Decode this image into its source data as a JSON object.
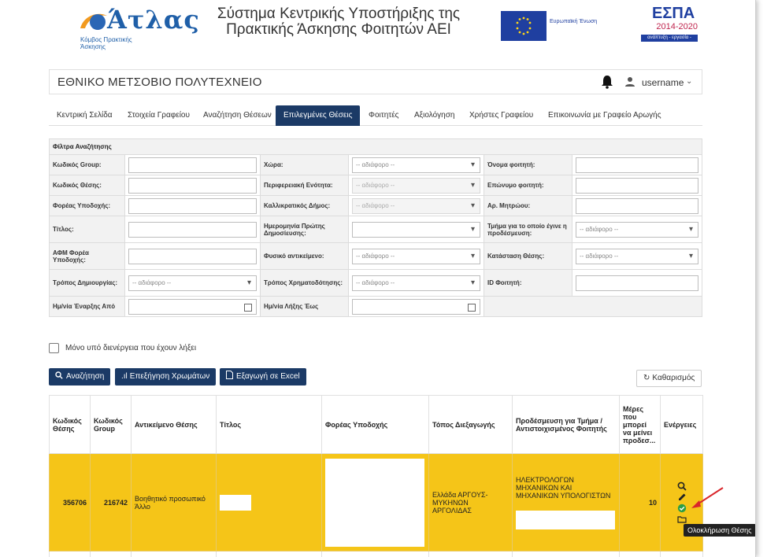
{
  "header": {
    "logo_title": "Άτλας",
    "logo_subtitle": "Κόμβος Πρακτικής Άσκησης",
    "system_title_line1": "Σύστημα Κεντρικής Υποστήριξης της",
    "system_title_line2": "Πρακτικής Άσκησης Φοιτητών ΑΕΙ",
    "eu_text": "Ευρωπαϊκή Ένωση",
    "espa_title": "ΕΣΠΑ",
    "espa_years": "2014-2020",
    "espa_slogan": "ανάπτυξη - εργασία - αλληλεγγύη"
  },
  "topbar": {
    "institution": "ΕΘΝΙΚΟ ΜΕΤΣΟΒΙΟ ΠΟΛΥΤΕΧΝΕΙΟ",
    "username": "username"
  },
  "nav": {
    "tabs": [
      "Κεντρική Σελίδα",
      "Στοιχεία Γραφείου",
      "Αναζήτηση Θέσεων",
      "Επιλεγμένες Θέσεις",
      "Φοιτητές",
      "Αξιολόγηση",
      "Χρήστες Γραφείου",
      "Επικοινωνία με Γραφείο Αρωγής"
    ],
    "active_index": 3
  },
  "filters": {
    "title": "Φίλτρα Αναζήτησης",
    "any": "-- αδιάφορο --",
    "group_code": "Κωδικός Group:",
    "country": "Χώρα:",
    "student_name": "Όνομα φοιτητή:",
    "position_code": "Κωδικός Θέσης:",
    "regional_unit": "Περιφερειακή Ενότητα:",
    "student_surname": "Επώνυμο φοιτητή:",
    "host_org": "Φορέας Υποδοχής:",
    "municipality": "Καλλικρατικός Δήμος:",
    "reg_number": "Αρ. Μητρώου:",
    "title_label": "Τίτλος:",
    "first_pub_date": "Ημερομηνία Πρώτης Δημοσίευσης:",
    "dept_preassigned": "Τμήμα για το οποίο έγινε η προδέσμευση:",
    "host_afm": "ΑΦΜ Φορέα Υποδοχής:",
    "physical_object": "Φυσικό αντικείμενο:",
    "position_status": "Κατάσταση Θέσης:",
    "creation_method": "Τρόπος Δημιουργίας:",
    "funding_method": "Τρόπος Χρηματοδότησης:",
    "student_id": "ID Φοιτητή:",
    "start_date_from": "Ημ/νία Έναρξης Από",
    "end_date_to": "Ημ/νία Λήξης Έως"
  },
  "checkbox_label": "Μόνο υπό διενέργεια που έχουν λήξει",
  "buttons": {
    "search": "Αναζήτηση",
    "color_legend": "Επεξήγηση Χρωμάτων",
    "export_excel": "Εξαγωγή σε Excel",
    "clear": "Καθαρισμός"
  },
  "table": {
    "headers": [
      "Κωδικός Θέσης",
      "Κωδικός Group",
      "Αντικείμενο Θέσης",
      "Τίτλος",
      "Φορέας Υποδοχής",
      "Τόπος Διεξαγωγής",
      "Προδέσμευση για Τμήμα / Αντιστοιχισμένος Φοιτητής",
      "Μέρες που μπορεί να μείνει προδεσ...",
      "Ενέργειες"
    ],
    "row": {
      "position_code": "356706",
      "group_code": "216742",
      "subject": "Βοηθητικό προσωπικό Άλλο",
      "location": "Ελλάδα ΑΡΓΟΥΣ-ΜΥΚΗΝΩΝ ΑΡΓΟΛΙΔΑΣ",
      "department": "ΗΛΕΚΤΡΟΛΟΓΩΝ ΜΗΧΑΝΙΚΩΝ ΚΑΙ ΜΗΧΑΝΙΚΩΝ ΥΠΟΛΟΓΙΣΤΩΝ",
      "days_left": "10"
    },
    "row_color": "#f5c518"
  },
  "tooltip": "Ολοκλήρωση Θέσης",
  "colors": {
    "primary": "#1b3a66",
    "highlight": "#f5c518",
    "complete_green": "#2e9e44",
    "arrow_red": "#d9262b"
  }
}
